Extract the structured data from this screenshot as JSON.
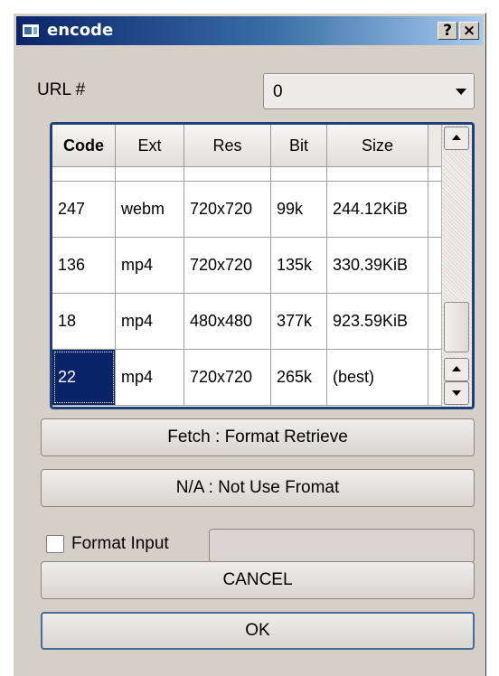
{
  "window": {
    "title": "encode",
    "help_label": "?",
    "close_label": "×"
  },
  "url": {
    "label": "URL #",
    "selected": "0"
  },
  "table": {
    "columns": [
      "Code",
      "Ext",
      "Res",
      "Bit",
      "Size"
    ],
    "partial_row": [
      "",
      "",
      "",
      "",
      ""
    ],
    "rows": [
      [
        "247",
        "webm",
        "720x720",
        "99k",
        "244.12KiB"
      ],
      [
        "136",
        "mp4",
        "720x720",
        "135k",
        "330.39KiB"
      ],
      [
        "18",
        "mp4",
        "480x480",
        "377k",
        "923.59KiB"
      ],
      [
        "22",
        "mp4",
        "720x720",
        "265k",
        "(best)"
      ]
    ],
    "selected_row": 3
  },
  "buttons": {
    "fetch": "Fetch : Format Retrieve",
    "not_use": "N/A : Not Use Fromat",
    "cancel": "CANCEL",
    "ok": "OK"
  },
  "format_input": {
    "label": "Format Input",
    "checked": false,
    "value": ""
  },
  "colors": {
    "title_start": "#0a246a",
    "selection": "#0a246a",
    "face": "#d4d0c8"
  }
}
